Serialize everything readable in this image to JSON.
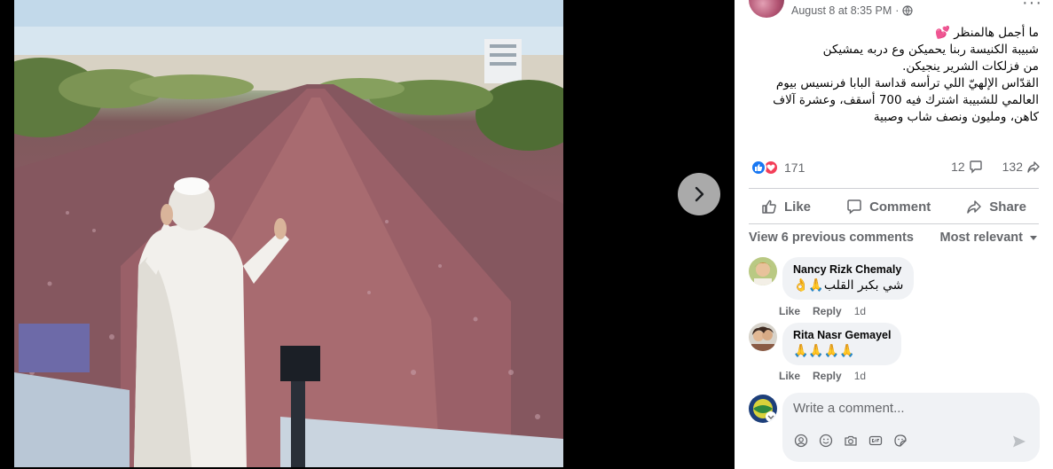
{
  "post": {
    "timestamp": "August 8 at 8:35 PM",
    "separator": "·",
    "text_lines": [
      "ما أجمل هالمنظر 💕",
      "شبيبة الكنيسة ربنا يحميكن وع دربه يمشيكن",
      "من فزلكات الشرير ينجيكن.",
      "القدّاس الإلهيّ اللي ترأسه قداسة البابا فرنسيس بيوم",
      "العالمي للشبيبة اشترك فيه 700 أسقف، وعشرة آلاف",
      "كاهن، ومليون ونصف شاب وصبية"
    ]
  },
  "stats": {
    "reactions_count": "171",
    "comments_count": "12",
    "shares_count": "132"
  },
  "actions": {
    "like": "Like",
    "comment": "Comment",
    "share": "Share"
  },
  "comments_section": {
    "view_previous": "View 6 previous comments",
    "sort_label": "Most relevant"
  },
  "comments": [
    {
      "name": "Nancy Rizk Chemaly",
      "text": "شي بكبر القلب🙏👌",
      "like": "Like",
      "reply": "Reply",
      "age": "1d"
    },
    {
      "name": "Rita Nasr Gemayel",
      "text": "🙏🙏🙏🙏",
      "like": "Like",
      "reply": "Reply",
      "age": "1d"
    }
  ],
  "composer": {
    "placeholder": "Write a comment..."
  },
  "colors": {
    "facebook_blue": "#1877f2",
    "love_red": "#f33e58",
    "secondary_text": "#65676b",
    "bubble_bg": "#f0f2f5"
  },
  "icons": [
    "chevron-right-icon",
    "globe-icon",
    "like-reaction-icon",
    "love-reaction-icon",
    "comment-icon",
    "share-icon",
    "thumbs-up-icon",
    "dropdown-caret-icon",
    "sticker-icon",
    "emoji-icon",
    "camera-icon",
    "gif-icon",
    "avatar-sticker-icon",
    "send-icon",
    "more-dots-icon"
  ]
}
